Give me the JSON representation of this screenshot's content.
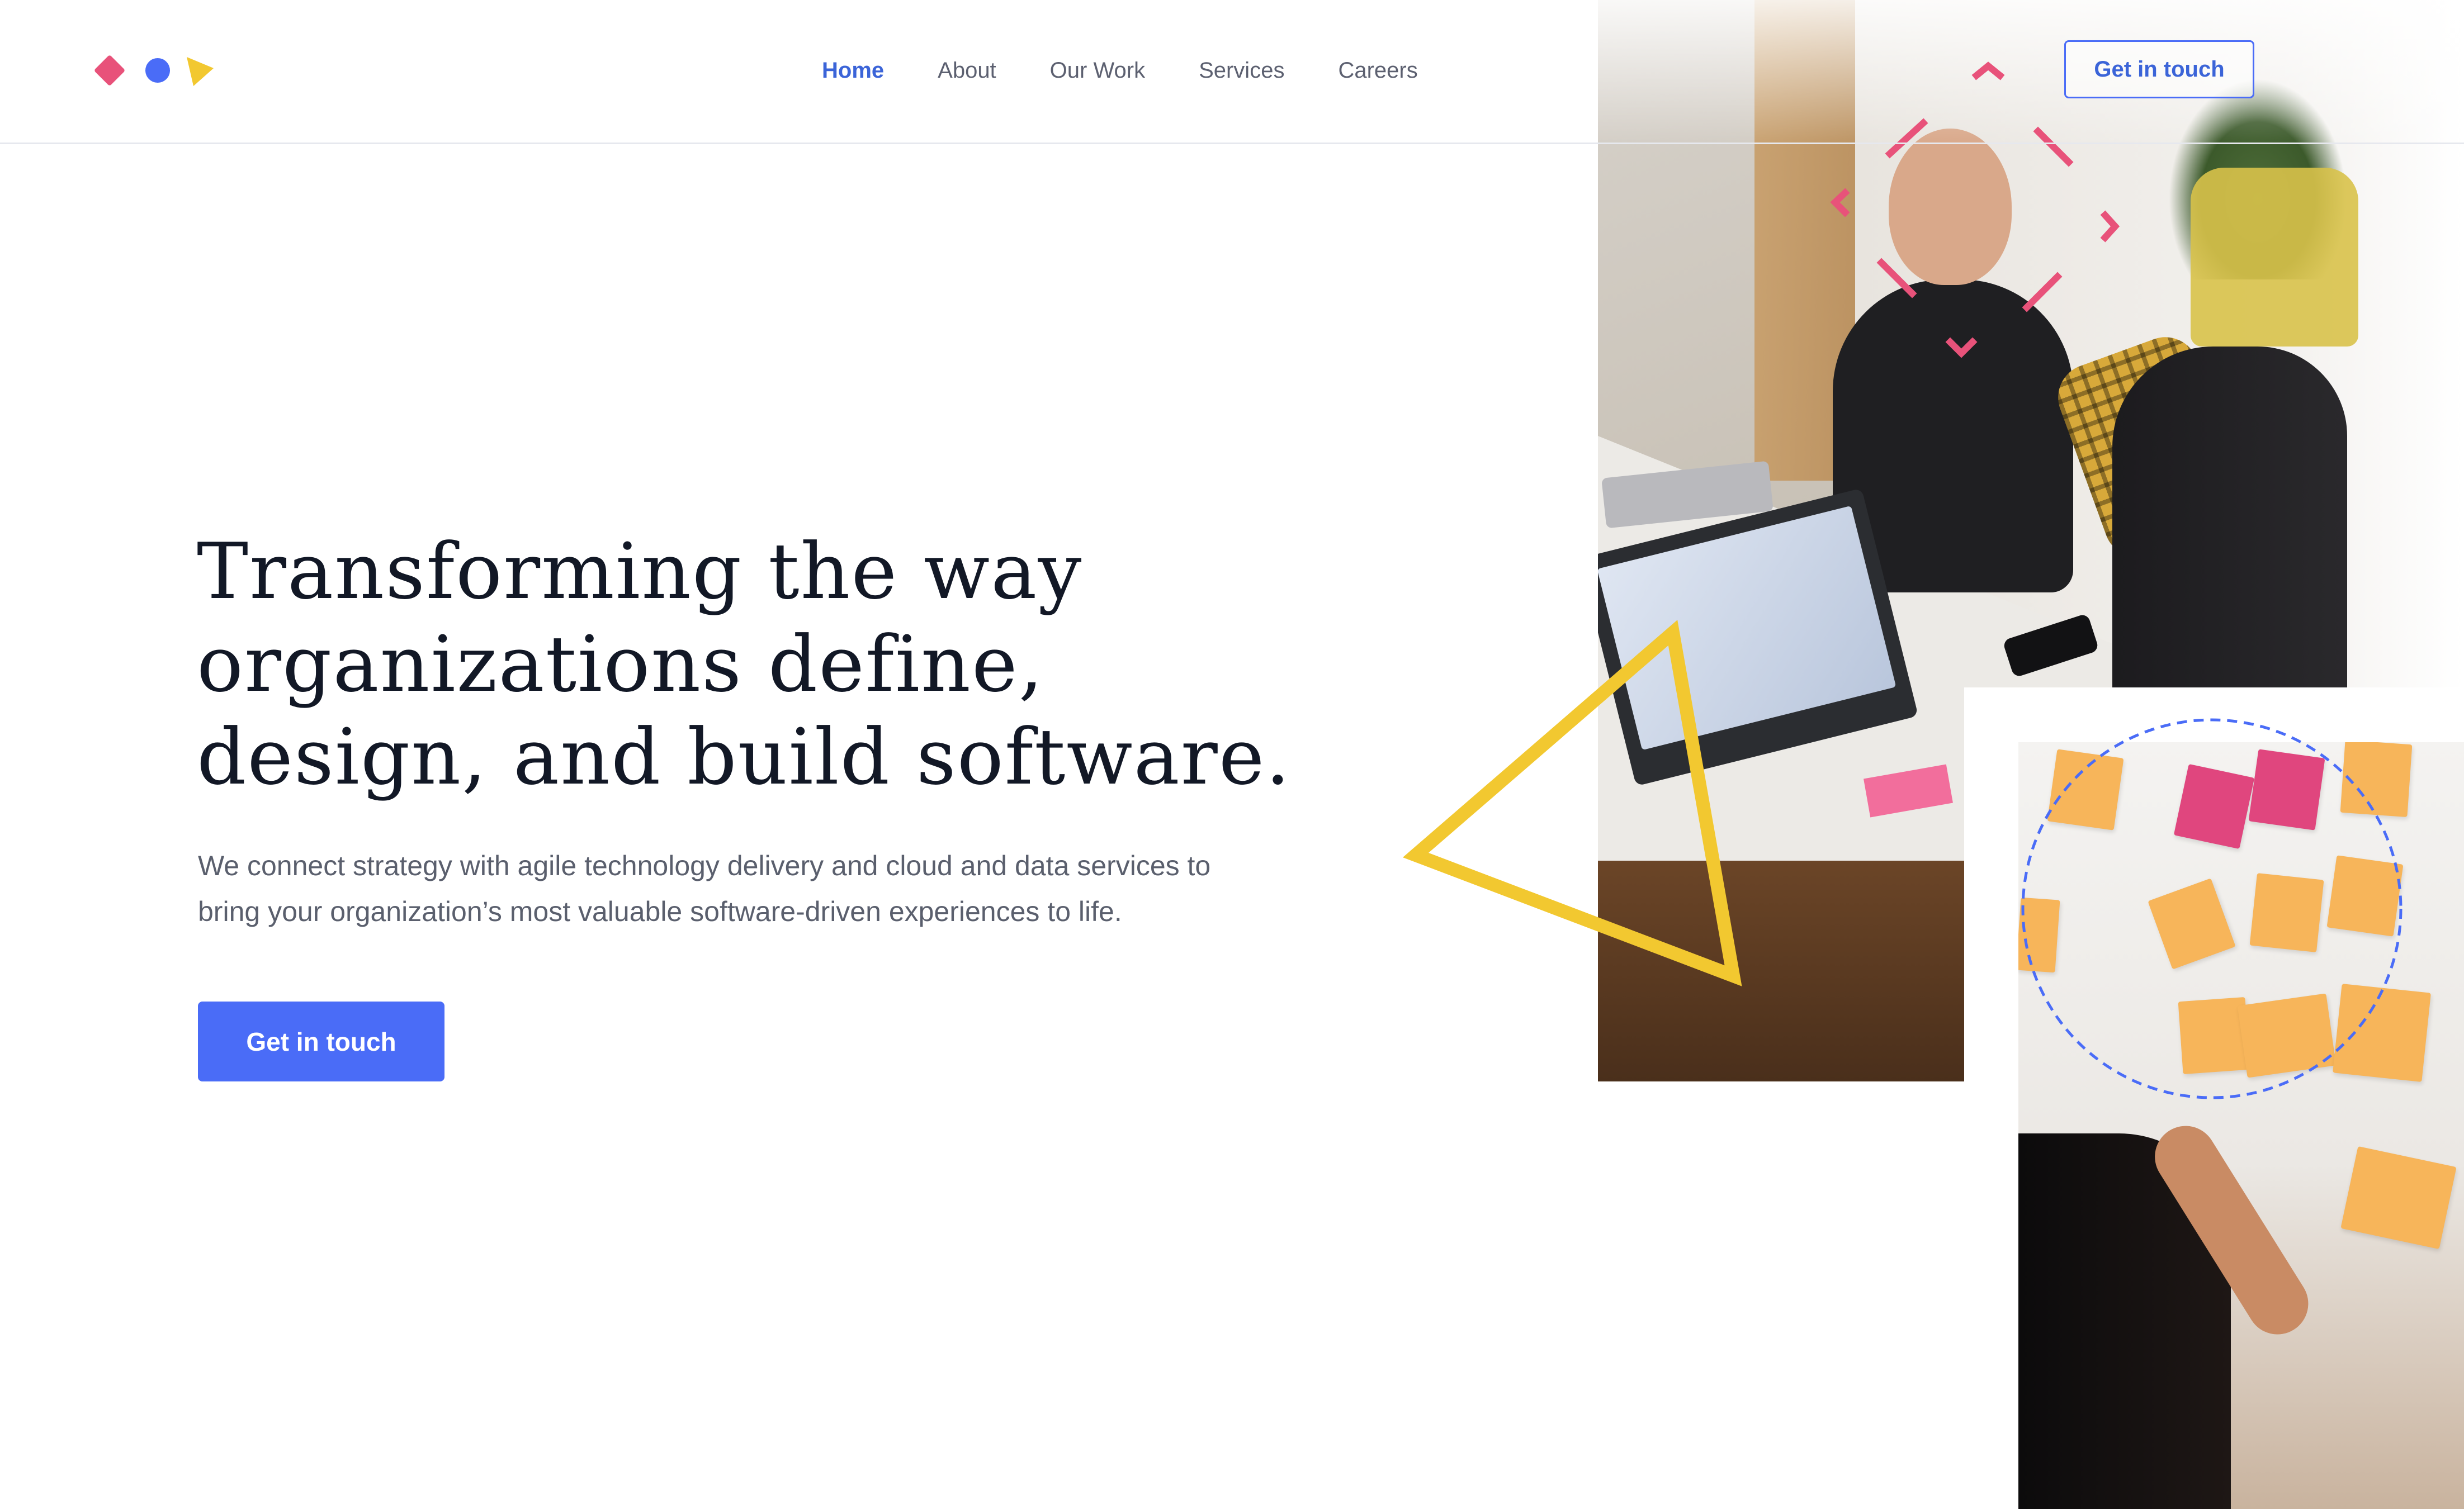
{
  "header": {
    "logo_shapes": [
      "diamond",
      "circle",
      "triangle"
    ],
    "nav": [
      {
        "label": "Home",
        "active": true
      },
      {
        "label": "About",
        "active": false
      },
      {
        "label": "Our Work",
        "active": false
      },
      {
        "label": "Services",
        "active": false
      },
      {
        "label": "Careers",
        "active": false
      }
    ],
    "cta_label": "Get in touch"
  },
  "hero": {
    "title": "Transforming the way\norganizations define,\ndesign, and build software.",
    "subtitle": "We connect strategy with agile technology delivery and cloud and data services to\nbring your organization’s most valuable software-driven experiences to life.",
    "cta_label": "Get in touch"
  },
  "colors": {
    "accent_blue": "#4a6cf7",
    "accent_pink": "#e8527a",
    "accent_yellow": "#f2c830",
    "heading": "#121826",
    "body": "#5a5f6d"
  },
  "icons": {
    "logo_diamond": "diamond-icon",
    "logo_circle": "circle-icon",
    "logo_triangle": "triangle-icon"
  }
}
